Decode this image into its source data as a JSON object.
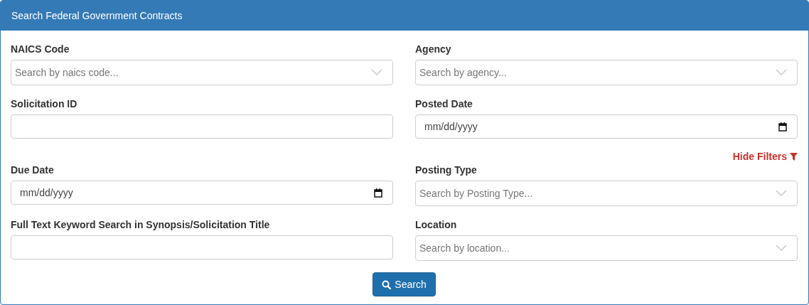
{
  "panel": {
    "title": "Search Federal Government Contracts"
  },
  "fields_top": [
    {
      "label": "NAICS Code",
      "kind": "select",
      "placeholder": "Search by naics code..."
    },
    {
      "label": "Agency",
      "kind": "select",
      "placeholder": "Search by agency..."
    },
    {
      "label": "Solicitation ID",
      "kind": "text"
    },
    {
      "label": "Posted Date",
      "kind": "date",
      "placeholder": "mm/dd/yyyy"
    }
  ],
  "filters_toggle": {
    "label": "Hide Filters"
  },
  "fields_bottom": [
    {
      "label": "Due Date",
      "kind": "date",
      "placeholder": "mm/dd/yyyy"
    },
    {
      "label": "Posting Type",
      "kind": "select",
      "placeholder": "Search by Posting Type..."
    },
    {
      "label": "Full Text Keyword Search in Synopsis/Solicitation Title",
      "kind": "text"
    },
    {
      "label": "Location",
      "kind": "select",
      "placeholder": "Search by location..."
    }
  ],
  "search_button": {
    "label": "Search"
  }
}
